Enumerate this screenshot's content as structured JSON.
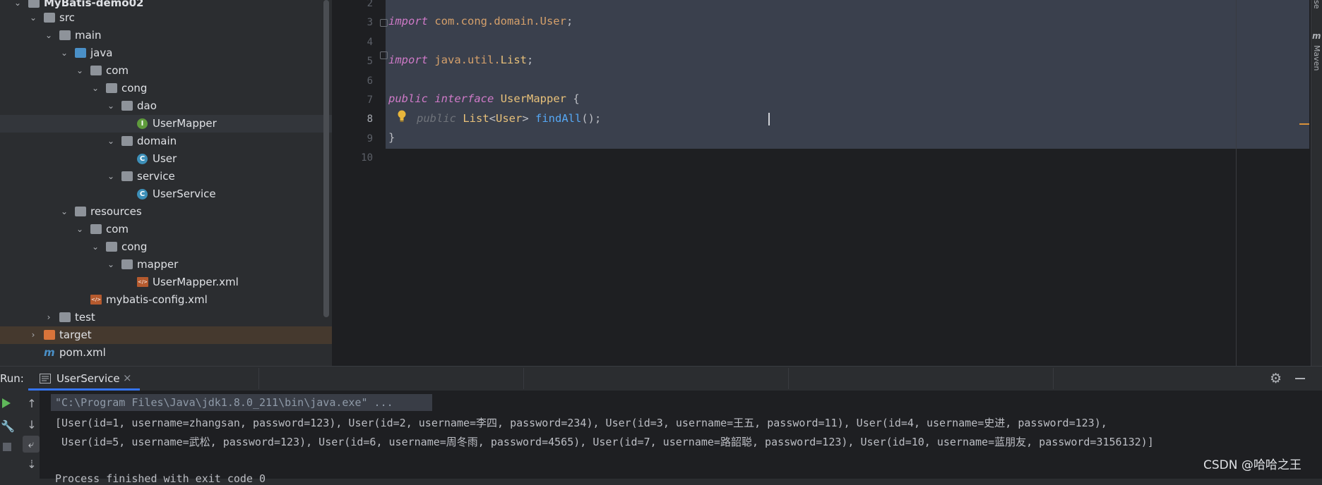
{
  "project_tree": {
    "items": [
      {
        "label": "MyBatis-demo02",
        "kind": "module",
        "indent": 0,
        "expanded": true
      },
      {
        "label": "src",
        "kind": "folder",
        "indent": 1,
        "expanded": true
      },
      {
        "label": "main",
        "kind": "folder",
        "indent": 2,
        "expanded": true
      },
      {
        "label": "java",
        "kind": "folder-source",
        "indent": 3,
        "expanded": true
      },
      {
        "label": "com",
        "kind": "package",
        "indent": 4,
        "expanded": true
      },
      {
        "label": "cong",
        "kind": "package",
        "indent": 5,
        "expanded": true
      },
      {
        "label": "dao",
        "kind": "package",
        "indent": 6,
        "expanded": true
      },
      {
        "label": "UserMapper",
        "kind": "interface",
        "indent": 7
      },
      {
        "label": "domain",
        "kind": "package",
        "indent": 6,
        "expanded": true
      },
      {
        "label": "User",
        "kind": "class",
        "indent": 7
      },
      {
        "label": "service",
        "kind": "package",
        "indent": 6,
        "expanded": true
      },
      {
        "label": "UserService",
        "kind": "class",
        "indent": 7
      },
      {
        "label": "resources",
        "kind": "folder-resources",
        "indent": 3,
        "expanded": true
      },
      {
        "label": "com",
        "kind": "folder",
        "indent": 4,
        "expanded": true
      },
      {
        "label": "cong",
        "kind": "folder",
        "indent": 5,
        "expanded": true
      },
      {
        "label": "mapper",
        "kind": "folder",
        "indent": 6,
        "expanded": true
      },
      {
        "label": "UserMapper.xml",
        "kind": "xml",
        "indent": 7
      },
      {
        "label": "mybatis-config.xml",
        "kind": "xml",
        "indent": 4
      },
      {
        "label": "test",
        "kind": "folder",
        "indent": 2,
        "expanded": false
      },
      {
        "label": "target",
        "kind": "folder-excluded",
        "indent": 1,
        "expanded": false
      },
      {
        "label": "pom.xml",
        "kind": "maven",
        "indent": 1
      }
    ]
  },
  "editor": {
    "line_numbers": [
      "2",
      "3",
      "4",
      "5",
      "6",
      "7",
      "8",
      "9",
      "10"
    ],
    "current_line": "8",
    "lines": {
      "l3_kw": "import",
      "l3_pkg": " com.cong.domain.",
      "l3_ty": "User",
      "l3_end": ";",
      "l5_kw": "import",
      "l5_pkg": " java.util.",
      "l5_ty": "List",
      "l5_end": ";",
      "l7_kw1": "public",
      "l7_kw2": "interface",
      "l7_ty": "UserMapper",
      "l7_end": " {",
      "l8_dim": "public",
      "l8_ty1": "List",
      "l8_lt": "<",
      "l8_ty2": "User",
      "l8_gt": "> ",
      "l8_fn": "findAll",
      "l8_end": "();",
      "l9": "}"
    }
  },
  "right_strip": {
    "maven_label": "Maven",
    "top_label": "se"
  },
  "run_panel": {
    "label": "Run:",
    "tab_label": "UserService",
    "output": [
      "\"C:\\Program Files\\Java\\jdk1.8.0_211\\bin\\java.exe\" ...",
      "[User(id=1, username=zhangsan, password=123), User(id=2, username=李四, password=234), User(id=3, username=王五, password=11), User(id=4, username=史进, password=123),",
      " User(id=5, username=武松, password=123), User(id=6, username=周冬雨, password=4565), User(id=7, username=路韶聪, password=123), User(id=10, username=蓝朋友, password=3156132)]",
      "",
      "Process finished with exit code 0"
    ]
  },
  "watermark": "CSDN @哈哈之王",
  "colors": {
    "accent": "#3574f0",
    "keyword": "#cf7ac8",
    "type": "#e8c17a",
    "function": "#56a8f5"
  }
}
